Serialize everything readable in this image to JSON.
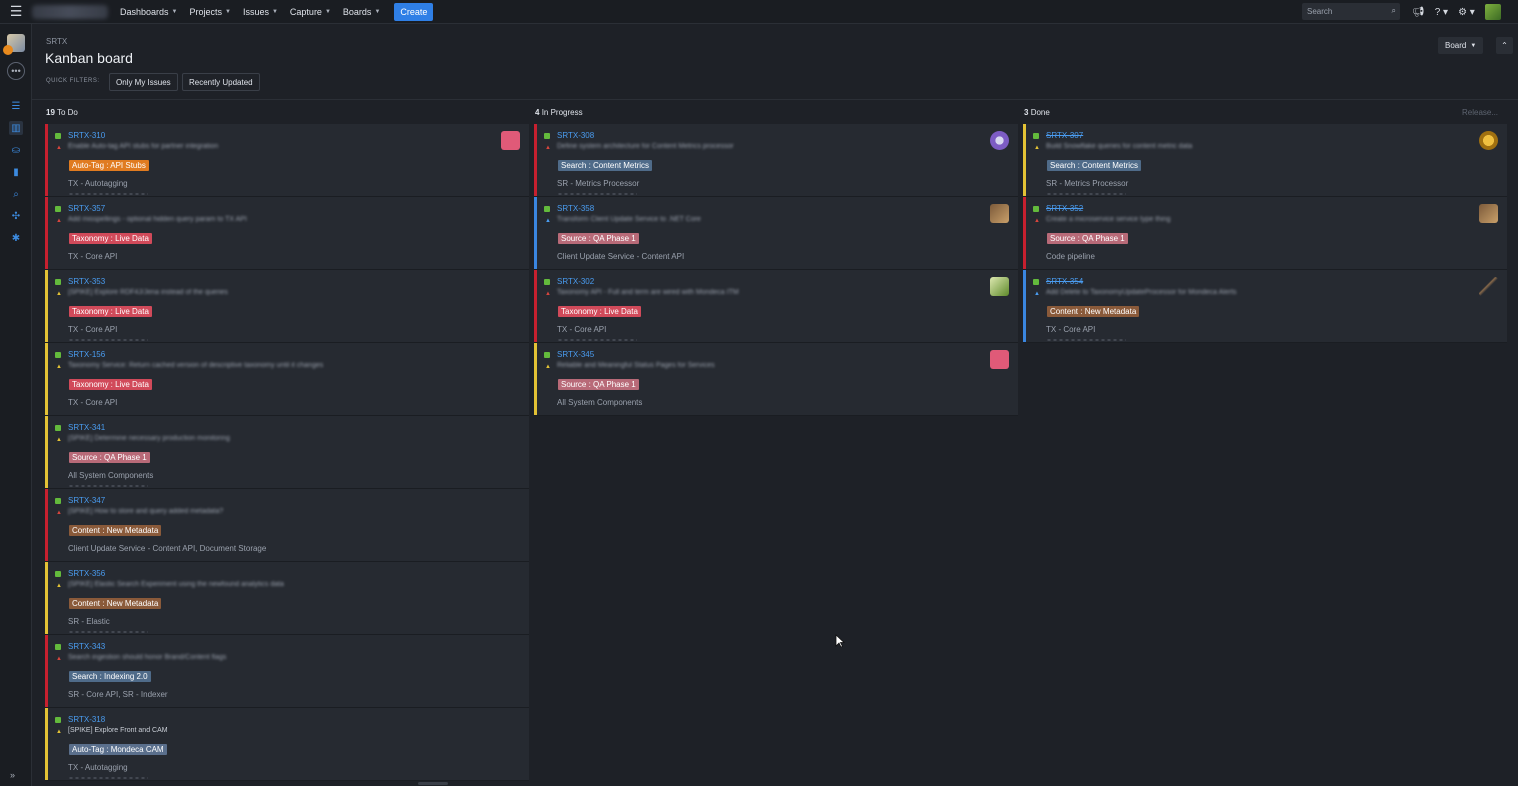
{
  "topbar": {
    "nav": [
      {
        "label": "Dashboards"
      },
      {
        "label": "Projects"
      },
      {
        "label": "Issues"
      },
      {
        "label": "Capture"
      },
      {
        "label": "Boards"
      }
    ],
    "create_label": "Create",
    "search_placeholder": "Search",
    "icons": [
      "megaphone-icon",
      "help-icon",
      "gear-icon"
    ]
  },
  "header": {
    "breadcrumb": "SRTX",
    "title": "Kanban board",
    "board_menu": "Board",
    "quick_filters_label": "QUICK FILTERS:",
    "quick_filters": [
      "Only My Issues",
      "Recently Updated"
    ]
  },
  "columns": [
    {
      "count": "19",
      "name": "To Do"
    },
    {
      "count": "4",
      "name": "In Progress"
    },
    {
      "count": "3",
      "name": "Done",
      "release": "Release..."
    }
  ],
  "todo": [
    {
      "key": "SRTX-310",
      "summary": "Enable Auto-tag API stubs for partner integration",
      "epic": "Auto-Tag : API Stubs",
      "epic_color": "orange",
      "component": "TX - Autotagging",
      "bar": "red",
      "assignee": "pink"
    },
    {
      "key": "SRTX-357",
      "summary": "Add misspellings - optional hidden query param to TX API",
      "epic": "Taxonomy : Live Data",
      "epic_color": "red",
      "component": "TX - Core API",
      "bar": "red"
    },
    {
      "key": "SRTX-353",
      "summary": "[SPIKE] Explore RDF4J/Jena instead of the queries",
      "epic": "Taxonomy : Live Data",
      "epic_color": "red",
      "component": "TX - Core API",
      "bar": "yellow"
    },
    {
      "key": "SRTX-156",
      "summary": "Taxonomy Service: Return cached version of descriptive taxonomy until it changes",
      "epic": "Taxonomy : Live Data",
      "epic_color": "red",
      "component": "TX - Core API",
      "bar": "yellow"
    },
    {
      "key": "SRTX-341",
      "summary": "[SPIKE] Determine necessary production monitoring",
      "epic": "Source : QA Phase 1",
      "epic_color": "rose",
      "component": "All System Components",
      "bar": "yellow"
    },
    {
      "key": "SRTX-347",
      "summary": "[SPIKE] How to store and query added metadata?",
      "epic": "Content : New Metadata",
      "epic_color": "brown",
      "component": "Client Update Service - Content API, Document Storage",
      "bar": "red"
    },
    {
      "key": "SRTX-356",
      "summary": "[SPIKE] Elastic Search Experiment using the newfound analytics data",
      "epic": "Content : New Metadata",
      "epic_color": "brown",
      "component": "SR - Elastic",
      "bar": "yellow"
    },
    {
      "key": "SRTX-343",
      "summary": "Search ingestion should honor Brand/Content flags",
      "epic": "Search : Indexing 2.0",
      "epic_color": "slate",
      "component": "SR - Core API, SR - Indexer",
      "bar": "red"
    },
    {
      "key": "SRTX-318",
      "summary": "[SPIKE] Explore Front and CAM",
      "epic": "Auto-Tag : Mondeca CAM",
      "epic_color": "steel",
      "component": "TX - Autotagging",
      "bar": "yellow",
      "clear": true
    }
  ],
  "inprogress": [
    {
      "key": "SRTX-308",
      "summary": "Define system architecture for Content Metrics processor",
      "epic": "Search : Content Metrics",
      "epic_color": "slate",
      "component": "SR - Metrics Processor",
      "bar": "red",
      "assignee": "purple"
    },
    {
      "key": "SRTX-358",
      "summary": "Transform Client Update Service to .NET Core",
      "epic": "Source : QA Phase 1",
      "epic_color": "rose",
      "component": "Client Update Service - Content API",
      "bar": "blue",
      "assignee": "photo"
    },
    {
      "key": "SRTX-302",
      "summary": "Taxonomy API - Full and term are wired with Mondeca ITM",
      "epic": "Taxonomy : Live Data",
      "epic_color": "red",
      "component": "TX - Core API",
      "bar": "red",
      "assignee": "green"
    },
    {
      "key": "SRTX-345",
      "summary": "Reliable and Meaningful Status Pages for Services",
      "epic": "Source : QA Phase 1",
      "epic_color": "rose",
      "component": "All System Components",
      "bar": "yellow",
      "assignee": "pink"
    }
  ],
  "done": [
    {
      "key": "SRTX-307",
      "summary": "Build Snowflake queries for content metric data",
      "epic": "Search : Content Metrics",
      "epic_color": "slate",
      "component": "SR - Metrics Processor",
      "bar": "yellow",
      "assignee": "gold"
    },
    {
      "key": "SRTX-352",
      "summary": "Create a microservice service type thing",
      "epic": "Source : QA Phase 1",
      "epic_color": "rose",
      "component": "Code pipeline",
      "bar": "red",
      "assignee": "photo"
    },
    {
      "key": "SRTX-354",
      "summary": "Add Delete to TaxonomyUpdateProcessor for Mondeca Alerts",
      "epic": "Content : New Metadata",
      "epic_color": "brown",
      "component": "TX - Core API",
      "bar": "blue",
      "assignee": "pencil"
    }
  ],
  "colors": {
    "accent": "#2f7fe6",
    "link": "#4a9cf0",
    "priority_red": "#c7202f",
    "priority_yellow": "#e3c235",
    "priority_blue": "#3a86e0"
  }
}
